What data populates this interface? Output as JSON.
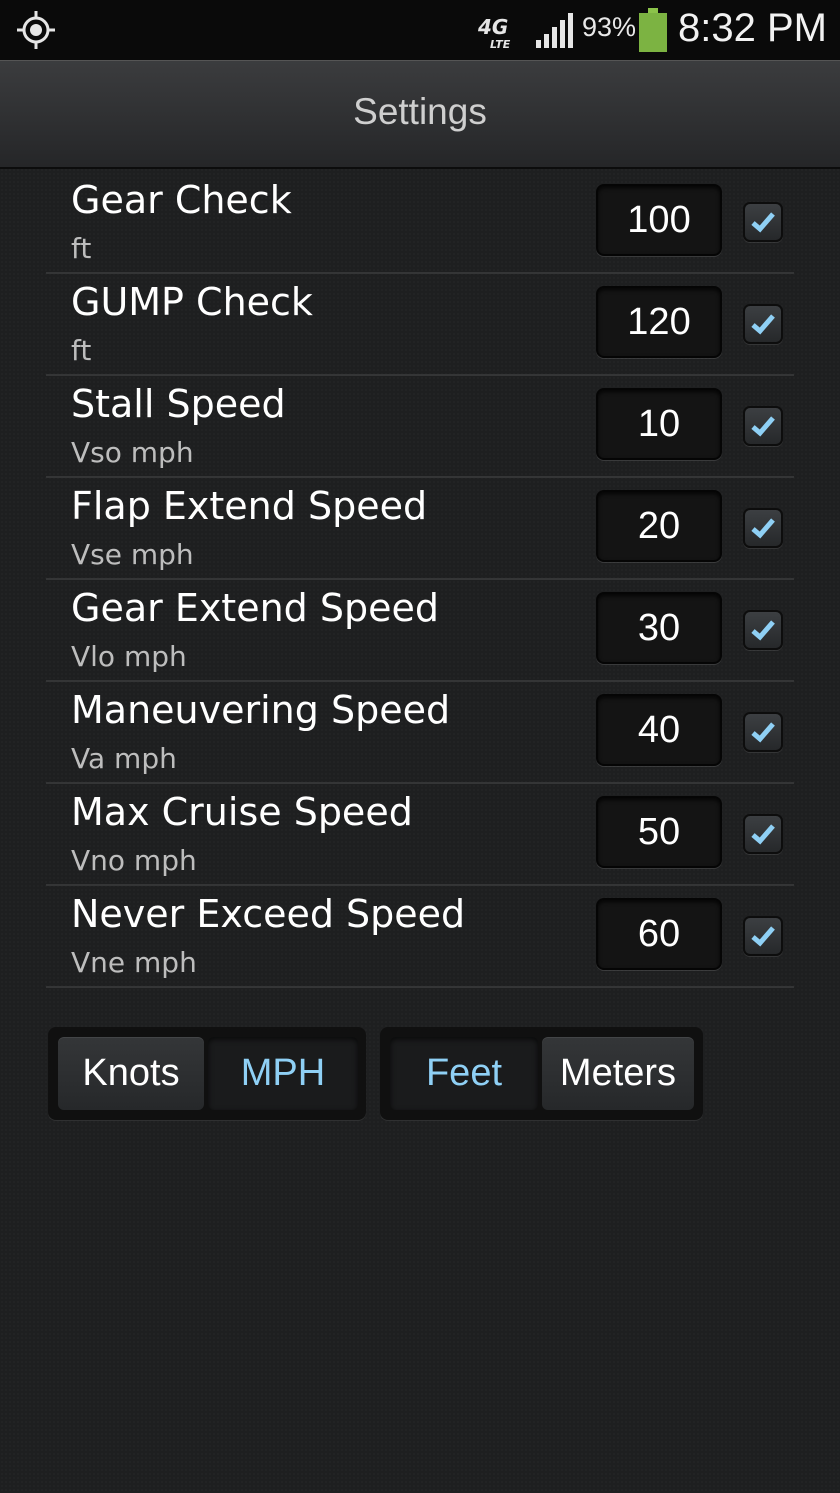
{
  "status_bar": {
    "network": "4G LTE",
    "battery_percent": "93%",
    "time": "8:32 PM",
    "battery_color": "#7cb342"
  },
  "header": {
    "title": "Settings"
  },
  "settings": [
    {
      "label": "Gear Check",
      "unit": "ft",
      "value": "100",
      "checked": true
    },
    {
      "label": "GUMP Check",
      "unit": "ft",
      "value": "120",
      "checked": true
    },
    {
      "label": "Stall Speed",
      "unit": "Vso mph",
      "value": "10",
      "checked": true
    },
    {
      "label": "Flap Extend Speed",
      "unit": "Vse mph",
      "value": "20",
      "checked": true
    },
    {
      "label": "Gear Extend Speed",
      "unit": "Vlo mph",
      "value": "30",
      "checked": true
    },
    {
      "label": "Maneuvering Speed",
      "unit": "Va mph",
      "value": "40",
      "checked": true
    },
    {
      "label": "Max Cruise Speed",
      "unit": "Vno mph",
      "value": "50",
      "checked": true
    },
    {
      "label": "Never Exceed Speed",
      "unit": "Vne mph",
      "value": "60",
      "checked": true
    }
  ],
  "speed_units": {
    "options": [
      "Knots",
      "MPH"
    ],
    "selected": "MPH"
  },
  "distance_units": {
    "options": [
      "Feet",
      "Meters"
    ],
    "selected": "Feet"
  },
  "colors": {
    "accent": "#8fd0f5",
    "check": "#8fd0f5"
  }
}
